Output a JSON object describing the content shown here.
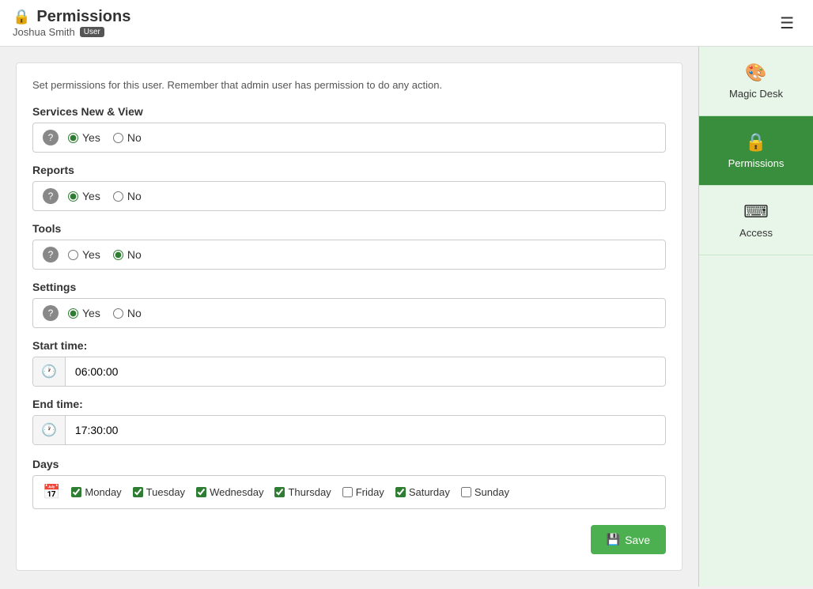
{
  "header": {
    "title": "Permissions",
    "user_name": "Joshua Smith",
    "user_badge": "User",
    "menu_icon": "☰",
    "lock_icon": "🔒"
  },
  "info": {
    "text": "Set permissions for this user. Remember that admin user has permission to do any action."
  },
  "sections": [
    {
      "id": "services",
      "label": "Services New & View",
      "yes": true
    },
    {
      "id": "reports",
      "label": "Reports",
      "yes": true
    },
    {
      "id": "tools",
      "label": "Tools",
      "yes": false
    },
    {
      "id": "settings",
      "label": "Settings",
      "yes": true
    }
  ],
  "start_time": {
    "label": "Start time:",
    "value": "06:00:00"
  },
  "end_time": {
    "label": "End time:",
    "value": "17:30:00"
  },
  "days": {
    "label": "Days",
    "items": [
      {
        "name": "Monday",
        "checked": true
      },
      {
        "name": "Tuesday",
        "checked": true
      },
      {
        "name": "Wednesday",
        "checked": true
      },
      {
        "name": "Thursday",
        "checked": true
      },
      {
        "name": "Friday",
        "checked": false
      },
      {
        "name": "Saturday",
        "checked": true
      },
      {
        "name": "Sunday",
        "checked": false
      }
    ]
  },
  "save_button": "Save",
  "sidebar": {
    "items": [
      {
        "id": "magic-desk",
        "label": "Magic Desk",
        "icon": "🎨",
        "active": false
      },
      {
        "id": "permissions",
        "label": "Permissions",
        "icon": "🔒",
        "active": true
      },
      {
        "id": "access",
        "label": "Access",
        "icon": "⌨",
        "active": false
      }
    ]
  }
}
